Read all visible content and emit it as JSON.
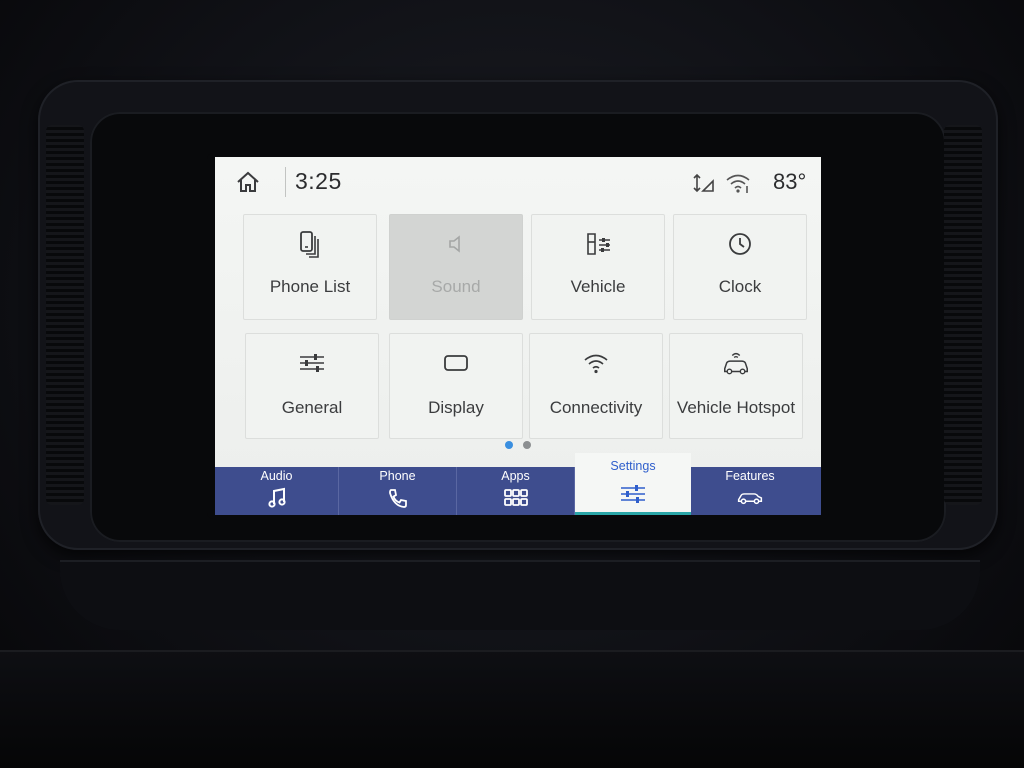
{
  "status": {
    "time": "3:25",
    "temperature": "83°",
    "icons": [
      "home-icon",
      "signal-icon",
      "wifi-icon"
    ]
  },
  "tiles": [
    {
      "label": "Phone List",
      "icon": "phone-list-icon",
      "enabled": true
    },
    {
      "label": "Sound",
      "icon": "speaker-icon",
      "enabled": false
    },
    {
      "label": "Vehicle",
      "icon": "vehicle-settings-icon",
      "enabled": true
    },
    {
      "label": "Clock",
      "icon": "clock-icon",
      "enabled": true
    },
    {
      "label": "General",
      "icon": "sliders-icon",
      "enabled": true
    },
    {
      "label": "Display",
      "icon": "display-icon",
      "enabled": true
    },
    {
      "label": "Connectivity",
      "icon": "wifi-icon",
      "enabled": true
    },
    {
      "label": "Vehicle Hotspot",
      "icon": "car-hotspot-icon",
      "enabled": true
    }
  ],
  "pagination": {
    "current": 1,
    "total": 2
  },
  "nav": [
    {
      "label": "Audio",
      "icon": "music-note-icon",
      "active": false
    },
    {
      "label": "Phone",
      "icon": "phone-icon",
      "active": false
    },
    {
      "label": "Apps",
      "icon": "apps-grid-icon",
      "active": false
    },
    {
      "label": "Settings",
      "icon": "sliders-icon",
      "active": true
    },
    {
      "label": "Features",
      "icon": "car-icon",
      "active": false
    }
  ],
  "colors": {
    "nav_bar": "#3e4d8e",
    "active_accent": "#2f5fcc",
    "active_underline": "#2aa6a8",
    "page_dot_active": "#3a8fe0"
  }
}
